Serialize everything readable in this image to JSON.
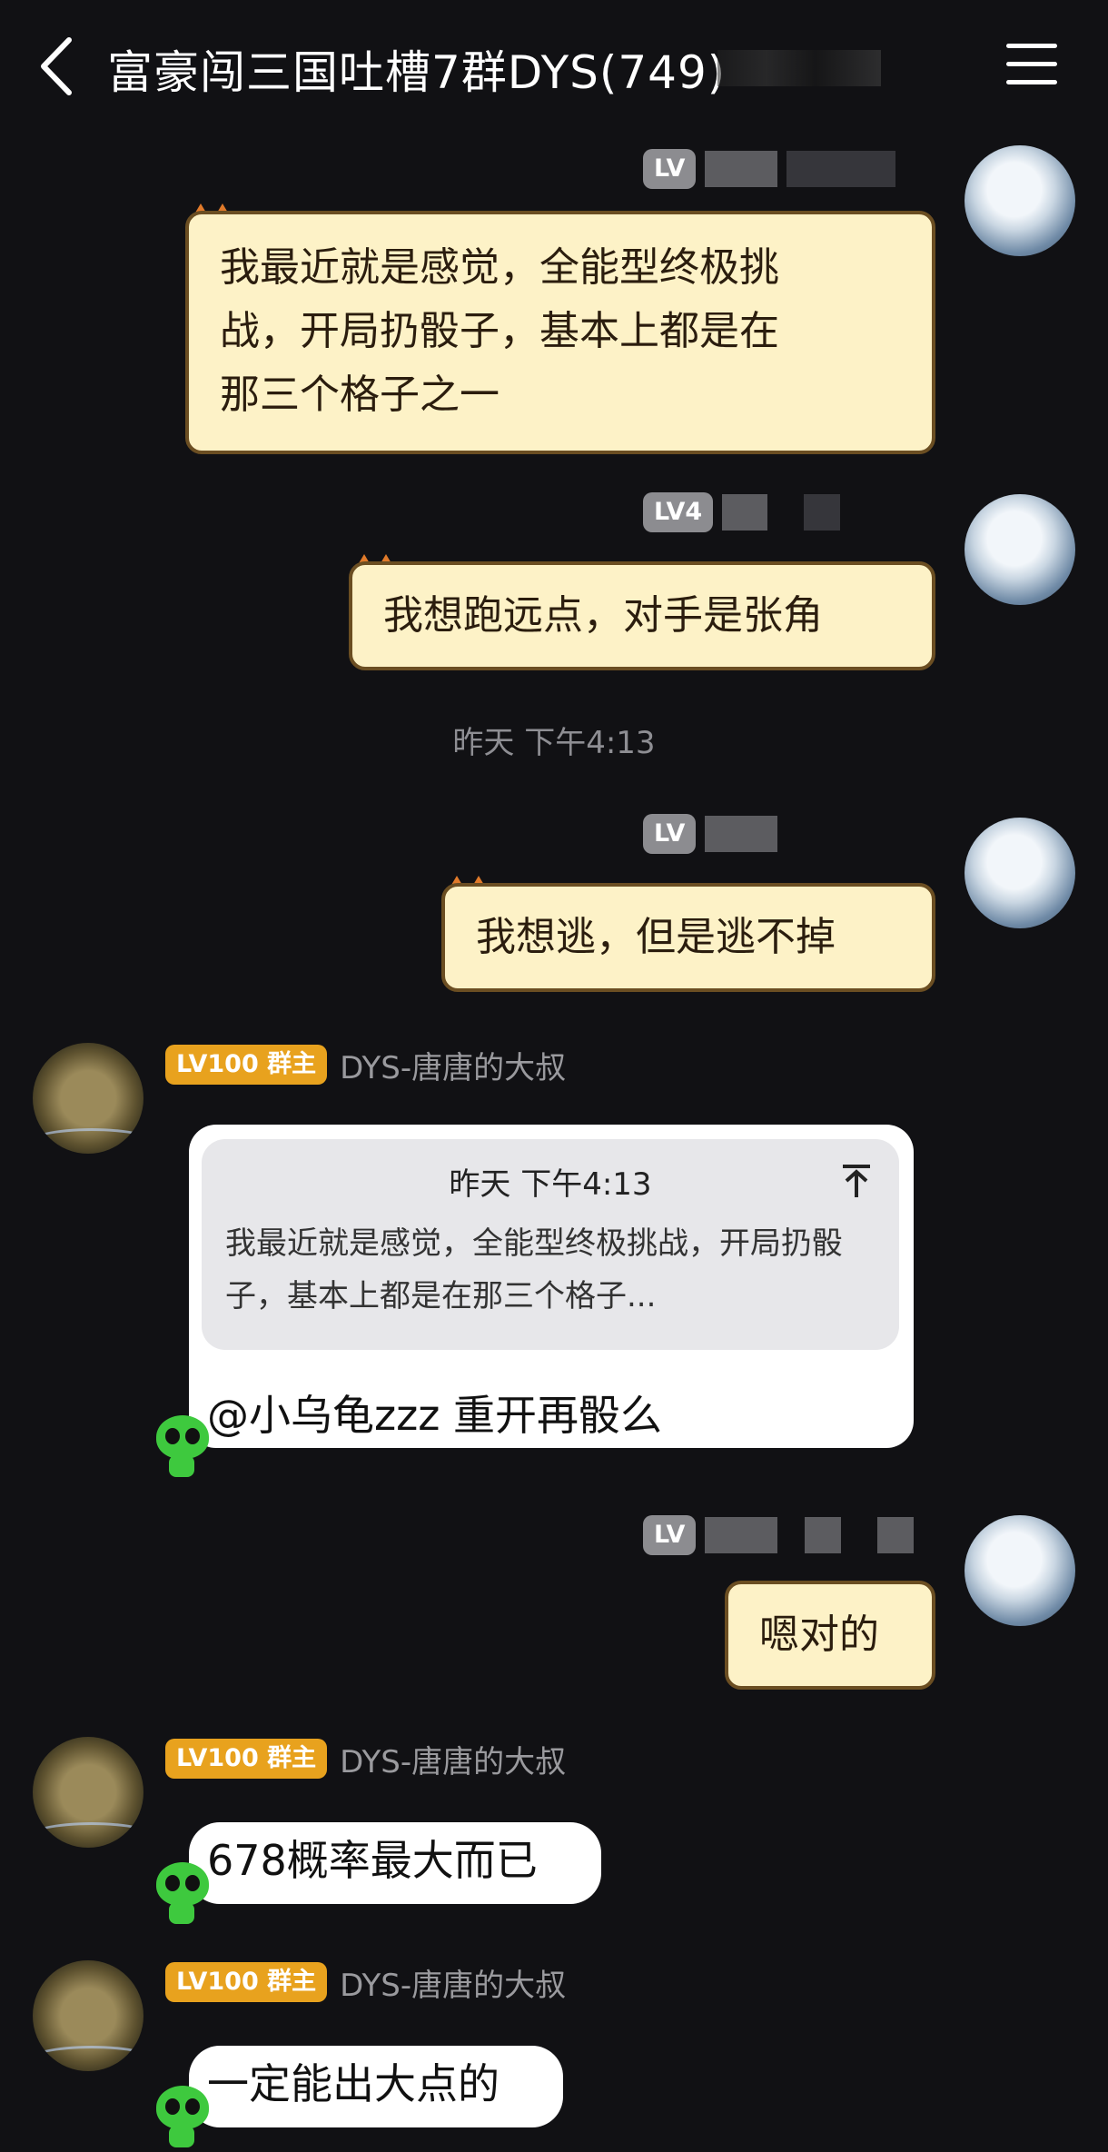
{
  "header": {
    "title": "富豪闯三国吐槽7群DYS(749)"
  },
  "level_badges": {
    "me_lv": "LV",
    "me_lv4": "LV4",
    "owner": "LV100 群主",
    "owner_cut": "LV100 群主"
  },
  "sender_name": "DYS-唐唐的大叔",
  "timestamps": {
    "t1": "昨天 下午4:13"
  },
  "messages": {
    "m1": [
      "我最近就是感觉，全能型终极挑",
      "战，开局扔骰子，基本上都是在",
      "那三个格子之一"
    ],
    "m2": "我想跑远点，对手是张角",
    "m3": "我想逃，但是逃不掉",
    "quote_time": "昨天 下午4:13",
    "quote_text": "我最近就是感觉，全能型终极挑战，开局扔骰子，基本上都是在那三个格子...",
    "reply": "@小乌龟zzz 重开再骰么",
    "m5": "嗯对的",
    "m6": "678概率最大而已",
    "m7": "一定能出大点的"
  }
}
